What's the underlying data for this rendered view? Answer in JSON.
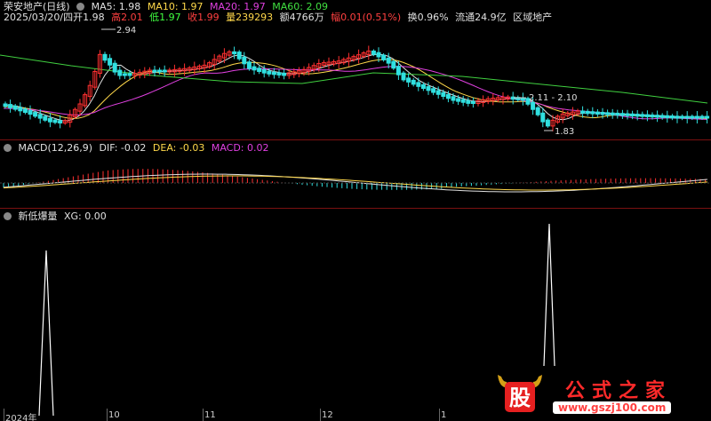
{
  "title": "荣安地产(日线)",
  "ma": {
    "ma5": "MA5: 1.98",
    "ma10": "MA10: 1.97",
    "ma20": "MA20: 1.97",
    "ma60": "MA60: 2.09"
  },
  "quote": {
    "date": "2025/03/20/四",
    "open": "开1.98",
    "high_label": "高",
    "high": "2.01",
    "low_label": "低",
    "low": "1.97",
    "close_label": "收",
    "close": "1.99",
    "volume": "量239293",
    "amount": "额4766万",
    "change_label": "幅",
    "change": "0.01(0.51%)",
    "turnover": "换0.96%",
    "float": "流通24.9亿",
    "sector": "区域地产"
  },
  "annotations": {
    "high_price": "2.94",
    "mid_range": "2.11 - 2.10",
    "low_price": "1.83"
  },
  "macd": {
    "name": "MACD(12,26,9)",
    "dif": "DIF: -0.02",
    "dea": "DEA: -0.03",
    "macd": "MACD: 0.02"
  },
  "indicator": {
    "name": "新低爆量",
    "xg": "XG: 0.00"
  },
  "xaxis": {
    "labels": [
      "2024年",
      "10",
      "11",
      "12",
      "1"
    ]
  },
  "watermark": {
    "logo_char": "股",
    "title": "公式之家",
    "url": "www.gszj100.com"
  },
  "colors": {
    "up": "#ff3030",
    "down": "#30e0e0",
    "ma5": "#e0e0e0",
    "ma10": "#ffd84a",
    "ma20": "#e040e0",
    "ma60": "#40d040"
  }
}
